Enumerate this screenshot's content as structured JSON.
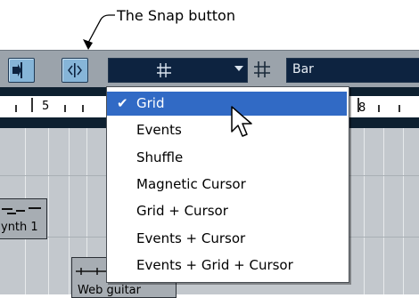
{
  "callout": {
    "label": "The Snap button"
  },
  "toolbar": {
    "snap_dropdown_icon": "grid-hash-icon",
    "grid_type_value": "Bar"
  },
  "ruler": {
    "marks": [
      "5",
      "8"
    ]
  },
  "menu": {
    "items": [
      {
        "label": "Grid",
        "checked": true,
        "highlighted": true
      },
      {
        "label": "Events"
      },
      {
        "label": "Shuffle"
      },
      {
        "label": "Magnetic Cursor"
      },
      {
        "label": "Grid + Cursor"
      },
      {
        "label": "Events + Cursor"
      },
      {
        "label": "Events + Grid + Cursor"
      }
    ]
  },
  "tracks": {
    "event1_label": "ynth 1",
    "event2_label": "Web guitar"
  },
  "colors": {
    "highlight": "#316ac5",
    "toolbar": "#9ba3ab",
    "dark_field": "#0d2340"
  }
}
